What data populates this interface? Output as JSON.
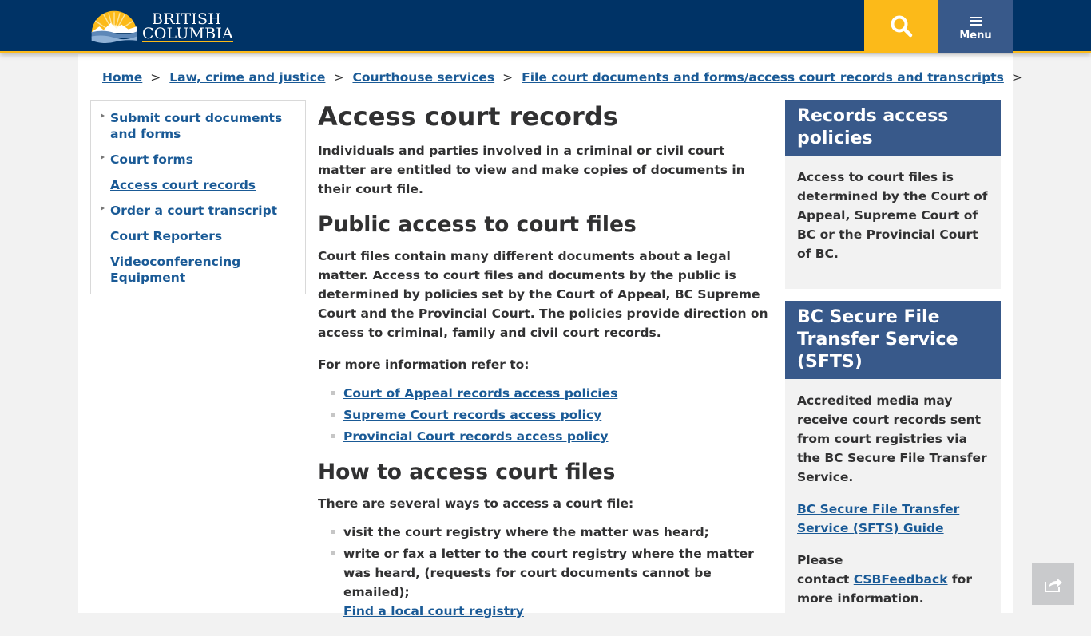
{
  "header": {
    "logo_line1": "British",
    "logo_line2": "Columbia",
    "search_icon": "search-icon",
    "menu_icon": "hamburger-icon",
    "menu_label": "Menu",
    "colors": {
      "nav": "#003366",
      "accent": "#fcba19",
      "menu_bg": "#38598a"
    }
  },
  "breadcrumb": {
    "items": [
      "Home",
      "Law, crime and justice",
      "Courthouse services",
      "File court documents and forms/access court records and transcripts"
    ],
    "separator": ">"
  },
  "sidenav": {
    "items": [
      {
        "label": "Submit court documents and forms",
        "expandable": true,
        "active": false
      },
      {
        "label": "Court forms",
        "expandable": true,
        "active": false
      },
      {
        "label": "Access court records",
        "expandable": false,
        "active": true
      },
      {
        "label": "Order a court transcript",
        "expandable": true,
        "active": false
      },
      {
        "label": "Court Reporters",
        "expandable": false,
        "active": false
      },
      {
        "label": "Videoconferencing Equipment",
        "expandable": false,
        "active": false
      }
    ]
  },
  "main": {
    "title": "Access court records",
    "intro": "Individuals and parties involved in a criminal or civil court matter are entitled to view and make copies of documents in their court file.",
    "section1": {
      "heading": "Public access to court files",
      "body": "Court files contain many different documents about a legal matter. Access to court files and documents by the public is determined by policies set by the Court of Appeal, BC Supreme Court and the Provincial Court. The policies provide direction on access to criminal, family and civil court records.",
      "refer": "For more information refer to:",
      "links": [
        "Court of Appeal records access policies",
        "Supreme Court records access policy",
        "Provincial Court records access policy"
      ]
    },
    "section2": {
      "heading": "How to access court files",
      "intro": "There are several ways to access a court file:",
      "items": [
        {
          "text": "visit the court registry where the matter was heard;"
        },
        {
          "text": "write or fax a letter to the court registry where the matter was heard, (requests for court documents cannot be emailed);",
          "link": "Find a local court registry"
        }
      ]
    }
  },
  "sidebar": {
    "cards": [
      {
        "title": "Records access policies",
        "body": "Access to court files is determined by the Court of Appeal, Supreme Court of BC or the Provincial Court of BC."
      },
      {
        "title": "BC Secure File Transfer Service (SFTS)",
        "body": "Accredited media may receive court records sent from court registries via the BC Secure File Transfer Service.",
        "link": "BC Secure File Transfer Service (SFTS) Guide",
        "contact_pre": "Please contact",
        "contact_link": "CSBFeedback",
        "contact_post": "for more information."
      }
    ]
  },
  "share": {
    "icon": "share-icon"
  }
}
